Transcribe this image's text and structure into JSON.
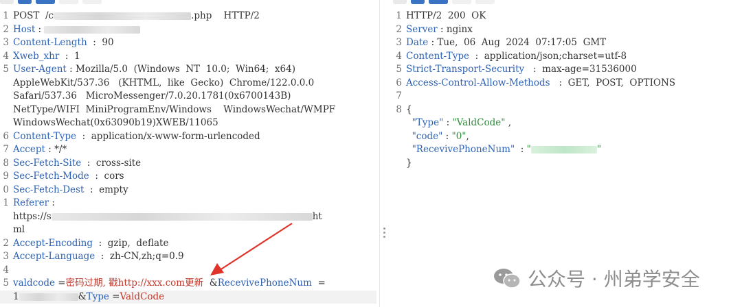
{
  "request": {
    "lines": [
      {
        "n": "1",
        "parts": [
          {
            "t": "POST  /c",
            "c": "plain"
          },
          {
            "blur": 200
          },
          {
            "t": ".php    HTTP/2",
            "c": "plain"
          }
        ]
      },
      {
        "n": "2",
        "parts": [
          {
            "t": "Host",
            "c": "hdr"
          },
          {
            "t": " : ",
            "c": "plain"
          },
          {
            "blur": 140
          }
        ]
      },
      {
        "n": "3",
        "parts": [
          {
            "t": "Content-Length",
            "c": "hdr"
          },
          {
            "t": "  :  90",
            "c": "plain"
          }
        ]
      },
      {
        "n": "4",
        "parts": [
          {
            "t": "Xweb_xhr",
            "c": "hdr"
          },
          {
            "t": "  :  1",
            "c": "plain"
          }
        ]
      },
      {
        "n": "5",
        "parts": [
          {
            "t": "User-Agent",
            "c": "hdr"
          },
          {
            "t": " : Mozilla/5.0  (Windows  NT  10.0;  Win64;  x64)",
            "c": "plain"
          }
        ]
      },
      {
        "n": "",
        "parts": [
          {
            "t": "AppleWebKit/537.36   (KHTML,  like  Gecko)  Chrome/122.0.0.0",
            "c": "plain"
          }
        ]
      },
      {
        "n": "",
        "parts": [
          {
            "t": "Safari/537.36   MicroMessenger/7.0.20.1781(0x6700143B)",
            "c": "plain"
          }
        ]
      },
      {
        "n": "",
        "parts": [
          {
            "t": "NetType/WIFI  MiniProgramEnv/Windows    WindowsWechat/WMPF",
            "c": "plain"
          }
        ]
      },
      {
        "n": "",
        "parts": [
          {
            "t": "WindowsWechat(0x63090b19)XWEB/11065",
            "c": "plain"
          }
        ]
      },
      {
        "n": "6",
        "parts": [
          {
            "t": "Content-Type",
            "c": "hdr"
          },
          {
            "t": "  :  application/x-www-form-urlencoded",
            "c": "plain"
          }
        ]
      },
      {
        "n": "7",
        "parts": [
          {
            "t": "Accept",
            "c": "hdr"
          },
          {
            "t": " : */*",
            "c": "plain"
          }
        ]
      },
      {
        "n": "8",
        "parts": [
          {
            "t": "Sec-Fetch-Site",
            "c": "hdr"
          },
          {
            "t": "  :  cross-site",
            "c": "plain"
          }
        ]
      },
      {
        "n": "9",
        "parts": [
          {
            "t": "Sec-Fetch-Mode",
            "c": "hdr"
          },
          {
            "t": "  :  cors",
            "c": "plain"
          }
        ]
      },
      {
        "n": "0",
        "parts": [
          {
            "t": "Sec-Fetch-Dest",
            "c": "hdr"
          },
          {
            "t": "  :  empty",
            "c": "plain"
          }
        ]
      },
      {
        "n": "1",
        "parts": [
          {
            "t": "Referer",
            "c": "hdr"
          },
          {
            "t": " :",
            "c": "plain"
          }
        ]
      },
      {
        "n": "",
        "parts": [
          {
            "t": "https://s",
            "c": "plain"
          },
          {
            "blur": 380
          },
          {
            "t": "ht",
            "c": "plain"
          }
        ]
      },
      {
        "n": "",
        "parts": [
          {
            "t": "ml",
            "c": "plain"
          }
        ]
      },
      {
        "n": "2",
        "parts": [
          {
            "t": "Accept-Encoding",
            "c": "hdr"
          },
          {
            "t": "  :  gzip,  deflate",
            "c": "plain"
          }
        ]
      },
      {
        "n": "3",
        "parts": [
          {
            "t": "Accept-Language",
            "c": "hdr"
          },
          {
            "t": "  :  zh-CN,zh;q=0.9",
            "c": "plain"
          }
        ]
      },
      {
        "n": "4",
        "parts": []
      },
      {
        "n": "5",
        "parts": [
          {
            "t": "valdcode",
            "c": "hdr"
          },
          {
            "t": " =",
            "c": "plain"
          },
          {
            "t": "密码过期, 戳http://xxx.com更新",
            "c": "red"
          },
          {
            "t": "  &",
            "c": "plain"
          },
          {
            "t": "RecevivePhoneNum",
            "c": "hdr"
          },
          {
            "t": "  =",
            "c": "plain"
          }
        ]
      },
      {
        "n": "",
        "hl": true,
        "parts": [
          {
            "t": "1",
            "c": "plain"
          },
          {
            "blur": 86
          },
          {
            "t": "&",
            "c": "plain"
          },
          {
            "t": "Type",
            "c": "hdr"
          },
          {
            "t": " =",
            "c": "plain"
          },
          {
            "t": "ValdCode",
            "c": "red"
          }
        ]
      }
    ]
  },
  "response": {
    "lines": [
      {
        "n": "1",
        "parts": [
          {
            "t": "HTTP/2  200  OK",
            "c": "plain"
          }
        ]
      },
      {
        "n": "2",
        "parts": [
          {
            "t": "Server",
            "c": "hdr"
          },
          {
            "t": " : nginx",
            "c": "plain"
          }
        ]
      },
      {
        "n": "3",
        "parts": [
          {
            "t": "Date",
            "c": "hdr"
          },
          {
            "t": " : Tue,  06  Aug  2024  07:17:05  GMT",
            "c": "plain"
          }
        ]
      },
      {
        "n": "4",
        "parts": [
          {
            "t": "Content-Type",
            "c": "hdr"
          },
          {
            "t": "  :  application/json;charset=utf-8",
            "c": "plain"
          }
        ]
      },
      {
        "n": "5",
        "parts": [
          {
            "t": "Strict-Transport-Security",
            "c": "hdr"
          },
          {
            "t": "   :  max-age=31536000",
            "c": "plain"
          }
        ]
      },
      {
        "n": "6",
        "parts": [
          {
            "t": "Access-Control-Allow-Methods",
            "c": "hdr"
          },
          {
            "t": "   :  GET,  POST,  OPTIONS",
            "c": "plain"
          }
        ]
      },
      {
        "n": "7",
        "parts": []
      },
      {
        "n": "8",
        "parts": [
          {
            "t": "{",
            "c": "plain"
          }
        ]
      },
      {
        "n": "",
        "parts": [
          {
            "t": "  ",
            "c": "plain"
          },
          {
            "t": "\"Type\"",
            "c": "key"
          },
          {
            "t": " : ",
            "c": "plain"
          },
          {
            "t": "\"ValdCode\"",
            "c": "str"
          },
          {
            "t": " ,",
            "c": "plain"
          }
        ]
      },
      {
        "n": "",
        "parts": [
          {
            "t": "  ",
            "c": "plain"
          },
          {
            "t": "\"code\"",
            "c": "key"
          },
          {
            "t": " : ",
            "c": "plain"
          },
          {
            "t": "\"0\"",
            "c": "str"
          },
          {
            "t": ",",
            "c": "plain"
          }
        ]
      },
      {
        "n": "",
        "parts": [
          {
            "t": "  ",
            "c": "plain"
          },
          {
            "t": "\"RecevivePhoneNum\"",
            "c": "key"
          },
          {
            "t": "  : ",
            "c": "plain"
          },
          {
            "t": "\"",
            "c": "str"
          },
          {
            "blur": 96,
            "green": true
          },
          {
            "t": "\"",
            "c": "str"
          }
        ]
      },
      {
        "n": "",
        "parts": [
          {
            "t": "}",
            "c": "plain"
          }
        ]
      }
    ]
  },
  "watermark": {
    "text": "公众号 · 州弟学安全"
  },
  "colors": {
    "accent": "#3b73c4",
    "header": "#2d62b4",
    "string": "#2e8b3a",
    "highlight": "#c0392b"
  }
}
